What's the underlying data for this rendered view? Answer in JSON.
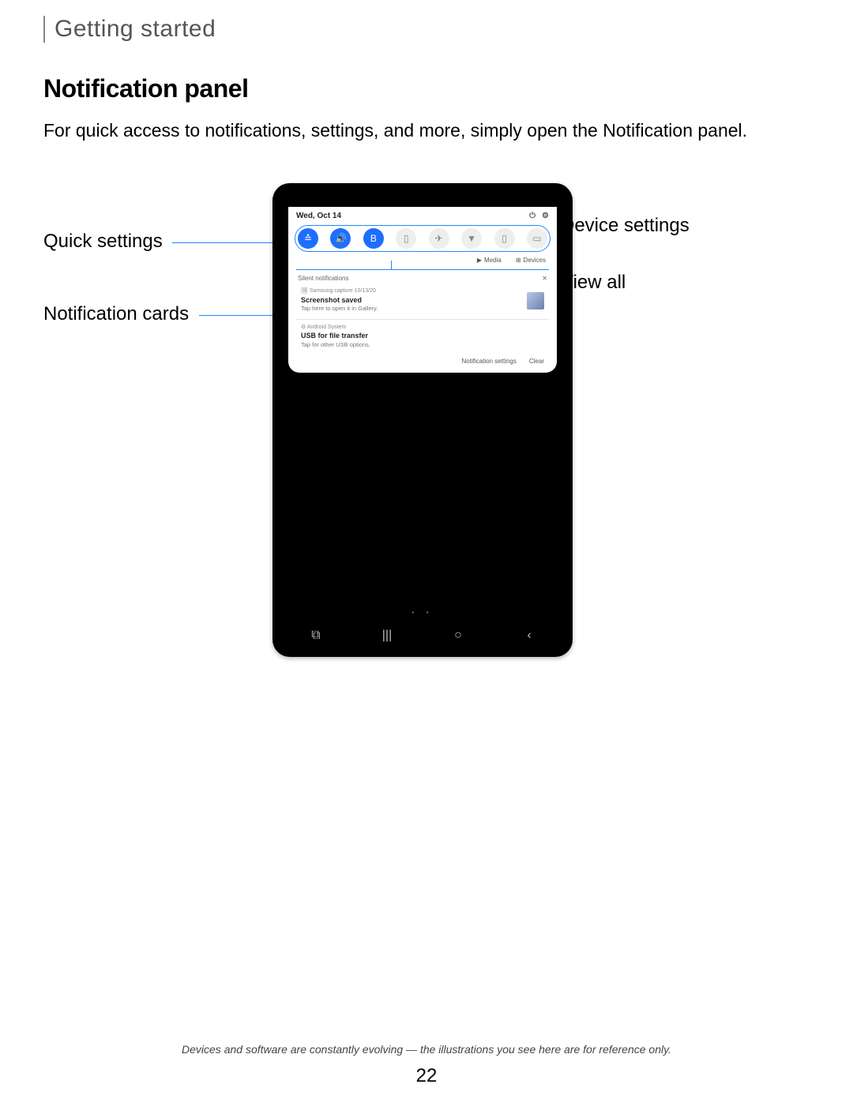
{
  "breadcrumb": "Getting started",
  "title": "Notification panel",
  "intro": "For quick access to notifications, settings, and more, simply open the Notification panel.",
  "callouts": {
    "quick_settings": "Quick settings",
    "notification_cards": "Notification cards",
    "device_settings": "Device settings",
    "view_all": "View all"
  },
  "device": {
    "date": "Wed, Oct 14",
    "header_icons": {
      "power": "power-icon",
      "settings": "gear-icon"
    },
    "quick_settings": [
      {
        "name": "wifi-icon",
        "glyph": "≙",
        "on": true
      },
      {
        "name": "sound-icon",
        "glyph": "🔊",
        "on": true
      },
      {
        "name": "bluetooth-icon",
        "glyph": "B",
        "on": true
      },
      {
        "name": "rotate-icon",
        "glyph": "▯",
        "on": false
      },
      {
        "name": "airplane-icon",
        "glyph": "✈",
        "on": false
      },
      {
        "name": "flashlight-icon",
        "glyph": "▼",
        "on": false
      },
      {
        "name": "battery-icon",
        "glyph": "▯",
        "on": false
      },
      {
        "name": "screenshot-icon",
        "glyph": "▭",
        "on": false
      }
    ],
    "view_row": {
      "media": "Media",
      "devices": "Devices"
    },
    "silent_label": "Silent notifications",
    "silent_close": "✕",
    "notif1": {
      "meta": "Samsung capture  10/13/20",
      "title": "Screenshot saved",
      "sub": "Tap here to open it in Gallery."
    },
    "notif2": {
      "meta": "Android System",
      "title": "USB for file transfer",
      "sub": "Tap for other USB options."
    },
    "footer": {
      "settings": "Notification settings",
      "clear": "Clear"
    }
  },
  "footnote": "Devices and software are constantly evolving — the illustrations you see here are for reference only.",
  "page_number": "22"
}
